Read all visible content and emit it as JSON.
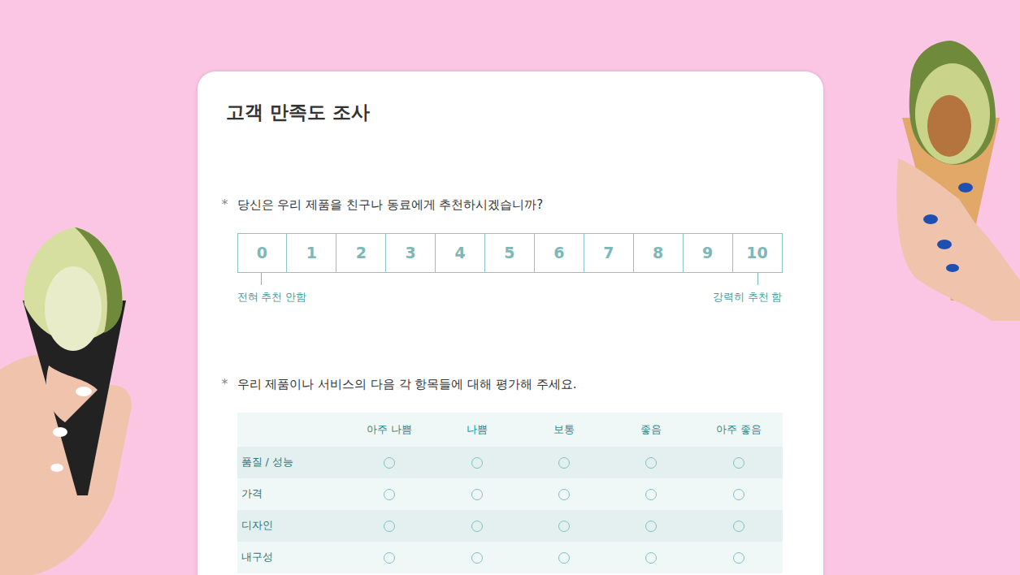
{
  "survey": {
    "title": "고객 만족도 조사"
  },
  "questions": [
    {
      "kind": "scale",
      "asterisk": "*",
      "text": "당신은 우리 제품을 친구나 동료에게 추천하시겠습니까?",
      "options": [
        {
          "label": "0",
          "selected": false
        },
        {
          "label": "1",
          "selected": false
        },
        {
          "label": "2",
          "selected": false
        },
        {
          "label": "3",
          "selected": false
        },
        {
          "label": "4",
          "selected": false
        },
        {
          "label": "5",
          "selected": false
        },
        {
          "label": "6",
          "selected": false
        },
        {
          "label": "7",
          "selected": false
        },
        {
          "label": "8",
          "selected": false
        },
        {
          "label": "9",
          "selected": false
        },
        {
          "label": "10",
          "selected": false
        }
      ],
      "low_label": "전혀 추천 안함",
      "high_label": "강력히 추천 함"
    },
    {
      "kind": "matrix",
      "asterisk": "*",
      "text": "우리 제품이나 서비스의 다음 각 항목들에 대해 평가해 주세요.",
      "columns": [
        "아주 나쁨",
        "나쁨",
        "보통",
        "좋음",
        "아주 좋음"
      ],
      "rows": [
        {
          "label": "품질 / 성능",
          "choices": [
            {
              "selected": false
            },
            {
              "selected": false
            },
            {
              "selected": false
            },
            {
              "selected": false
            },
            {
              "selected": false
            }
          ]
        },
        {
          "label": "가격",
          "choices": [
            {
              "selected": false
            },
            {
              "selected": false
            },
            {
              "selected": false
            },
            {
              "selected": false
            },
            {
              "selected": false
            }
          ]
        },
        {
          "label": "디자인",
          "choices": [
            {
              "selected": false
            },
            {
              "selected": false
            },
            {
              "selected": false
            },
            {
              "selected": false
            },
            {
              "selected": false
            }
          ]
        },
        {
          "label": "내구성",
          "choices": [
            {
              "selected": false
            },
            {
              "selected": false
            },
            {
              "selected": false
            },
            {
              "selected": false
            },
            {
              "selected": false
            }
          ]
        }
      ]
    }
  ]
}
